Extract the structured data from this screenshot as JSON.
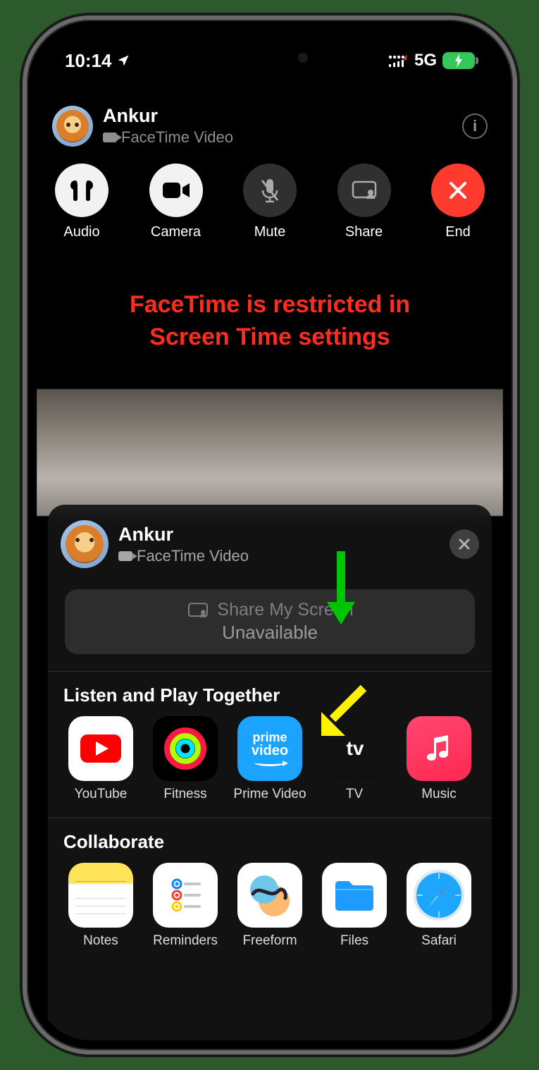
{
  "status": {
    "time": "10:14",
    "network_label": "5G"
  },
  "call": {
    "contact_name": "Ankur",
    "call_type": "FaceTime Video",
    "controls": {
      "audio": "Audio",
      "camera": "Camera",
      "mute": "Mute",
      "share": "Share",
      "end": "End"
    }
  },
  "annotation": {
    "line1": "FaceTime is restricted in",
    "line2": "Screen Time settings"
  },
  "share_sheet": {
    "contact_name": "Ankur",
    "call_type": "FaceTime Video",
    "share_button": {
      "title": "Share My Screen",
      "subtitle": "Unavailable"
    },
    "sections": {
      "listen": {
        "title": "Listen and Play Together",
        "apps": {
          "youtube": "YouTube",
          "fitness": "Fitness",
          "prime": "Prime Video",
          "tv": "TV",
          "music": "Music"
        }
      },
      "collaborate": {
        "title": "Collaborate",
        "apps": {
          "notes": "Notes",
          "reminders": "Reminders",
          "freeform": "Freeform",
          "files": "Files",
          "safari": "Safari"
        }
      }
    }
  }
}
